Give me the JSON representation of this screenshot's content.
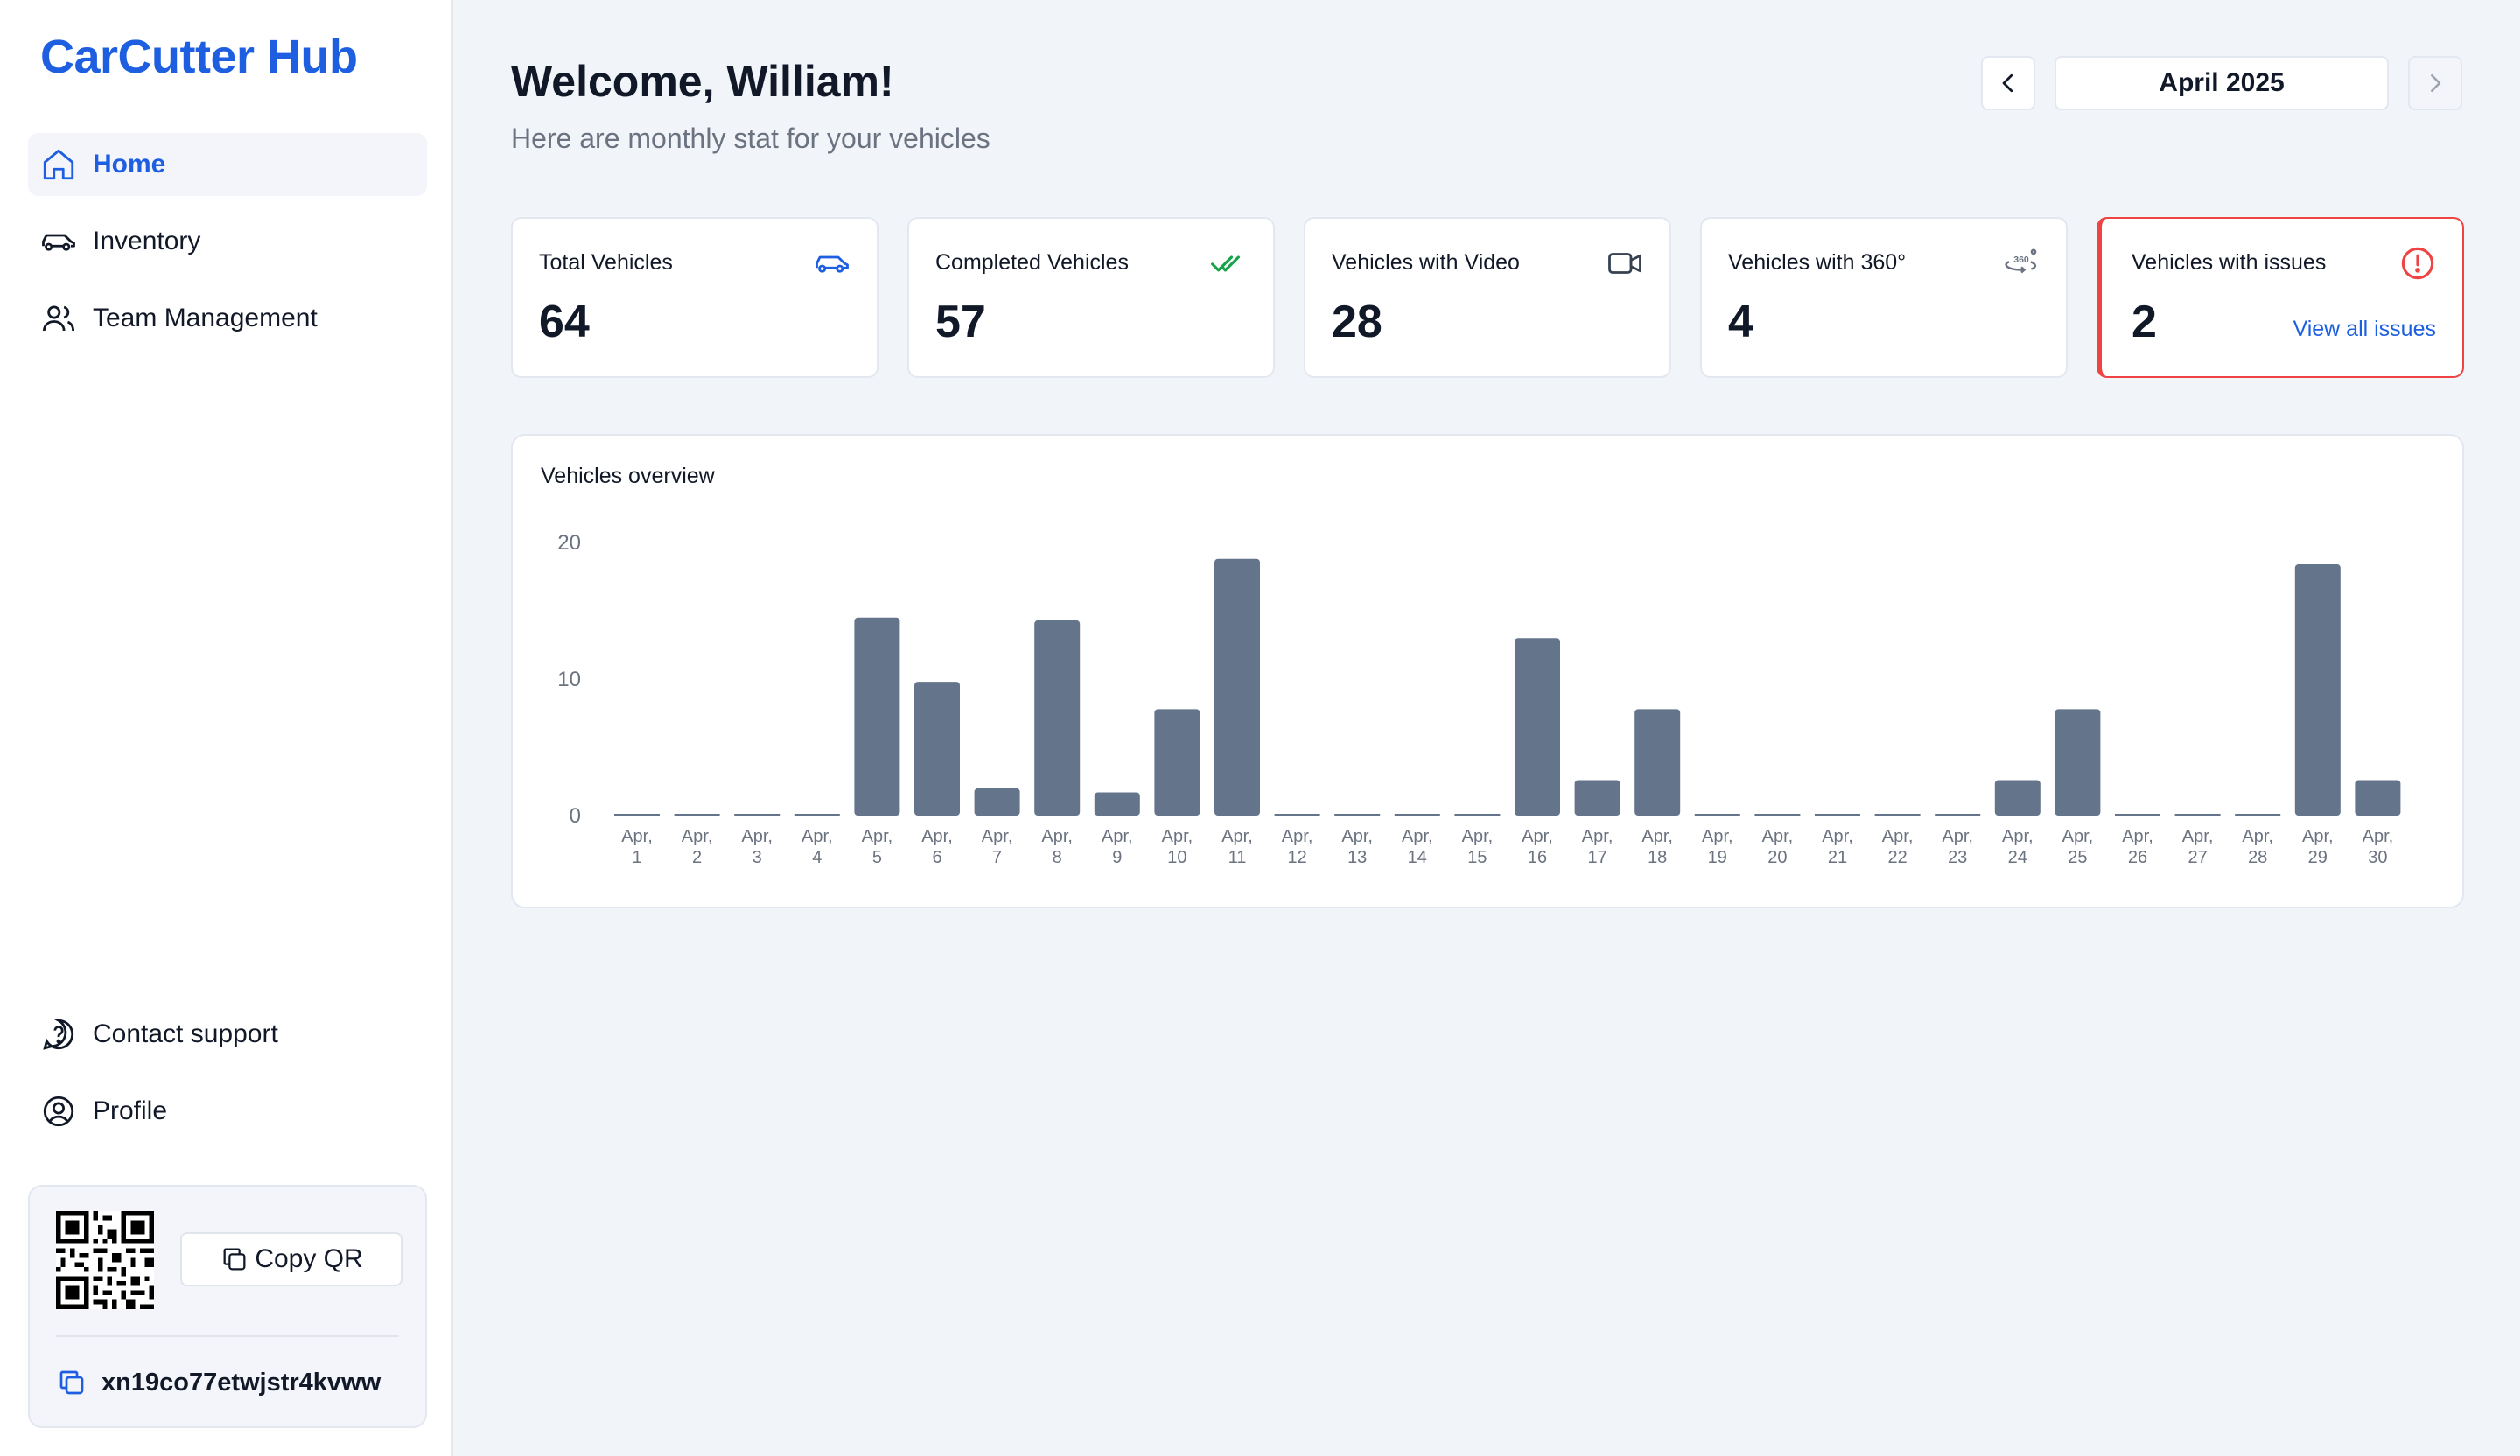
{
  "brand": "CarCutter Hub",
  "sidebar": {
    "nav": [
      {
        "label": "Home",
        "icon": "home-icon",
        "active": true
      },
      {
        "label": "Inventory",
        "icon": "car-icon",
        "active": false
      },
      {
        "label": "Team Management",
        "icon": "users-icon",
        "active": false
      }
    ],
    "bottom": [
      {
        "label": "Contact support",
        "icon": "support-icon"
      },
      {
        "label": "Profile",
        "icon": "profile-icon"
      }
    ],
    "qr": {
      "copy_label": "Copy QR",
      "code": "xn19co77etwjstr4kvww"
    }
  },
  "header": {
    "welcome": "Welcome, William!",
    "subtitle": "Here are monthly stat for your vehicles",
    "month": "April 2025"
  },
  "stats": [
    {
      "label": "Total Vehicles",
      "value": "64",
      "icon": "car-icon"
    },
    {
      "label": "Completed Vehicles",
      "value": "57",
      "icon": "double-check-icon"
    },
    {
      "label": "Vehicles with Video",
      "value": "28",
      "icon": "video-icon"
    },
    {
      "label": "Vehicles with 360°",
      "value": "4",
      "icon": "360-icon"
    },
    {
      "label": "Vehicles with issues",
      "value": "2",
      "icon": "alert-icon",
      "link": "View all issues"
    }
  ],
  "colors": {
    "accent": "#1d5fe0",
    "bar": "#64748b",
    "alert": "#ef4444",
    "check": "#16a34a"
  },
  "chart_data": {
    "type": "bar",
    "title": "Vehicles overview",
    "categories": [
      "Apr, 1",
      "Apr, 2",
      "Apr, 3",
      "Apr, 4",
      "Apr, 5",
      "Apr, 6",
      "Apr, 7",
      "Apr, 8",
      "Apr, 9",
      "Apr, 10",
      "Apr, 11",
      "Apr, 12",
      "Apr, 13",
      "Apr, 14",
      "Apr, 15",
      "Apr, 16",
      "Apr, 17",
      "Apr, 18",
      "Apr, 19",
      "Apr, 20",
      "Apr, 21",
      "Apr, 22",
      "Apr, 23",
      "Apr, 24",
      "Apr, 25",
      "Apr, 26",
      "Apr, 27",
      "Apr, 28",
      "Apr, 29",
      "Apr, 30"
    ],
    "values": [
      0,
      0,
      0,
      0,
      14.5,
      9.8,
      2,
      14.3,
      1.7,
      7.8,
      18.8,
      0,
      0,
      0,
      0,
      13,
      2.6,
      7.8,
      0,
      0,
      0,
      0,
      0,
      2.6,
      7.8,
      0,
      0,
      0,
      18.4,
      2.6
    ],
    "yticks": [
      0,
      10,
      20
    ],
    "ylim": [
      0,
      20
    ],
    "xlabel": "",
    "ylabel": "",
    "grid": false
  }
}
